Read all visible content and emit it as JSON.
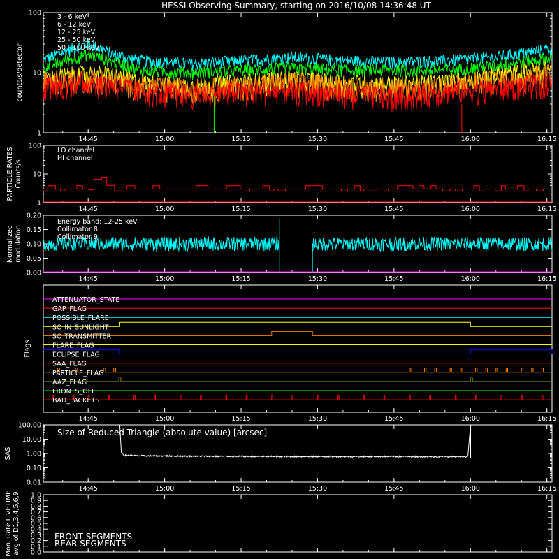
{
  "title": "HESSI Observing Summary, starting on 2016/10/08 14:36:48 UT",
  "x_ticks": [
    "14:45",
    "15:00",
    "15:15",
    "15:30",
    "15:45",
    "16:00",
    "16:15"
  ],
  "x_tick_minutes": [
    0,
    15,
    30,
    45,
    60,
    75,
    90
  ],
  "x_range_minutes": [
    -8.8,
    91.0
  ],
  "colors": {
    "bg": "#000000",
    "axis": "#ffffff",
    "red": "#ff0000",
    "orange": "#ff8000",
    "yellow": "#ffff00",
    "green": "#00ff00",
    "cyan": "#00ffff",
    "magenta": "#ff00ff",
    "blue": "#0000ff",
    "olive": "#808000",
    "lime": "#00ff00",
    "darkgreen": "#00a000"
  },
  "chart_data": [
    {
      "type": "line",
      "panel": "count-rates",
      "ylabel": "counts/s/detector",
      "yscale": "log",
      "ylim": [
        1,
        100
      ],
      "y_tick_labels": [
        "1",
        "10",
        "100"
      ],
      "y_tick_values": [
        1,
        10,
        100
      ],
      "series": [
        {
          "name": "3 - 6 keV",
          "color": "#ff0000",
          "x": [
            -8.8,
            0,
            5,
            10,
            20,
            30,
            40,
            50,
            60,
            70,
            80,
            91
          ],
          "y": [
            6,
            7,
            6.5,
            5,
            4.5,
            5,
            5,
            4.5,
            4,
            5,
            5.5,
            7
          ]
        },
        {
          "name": "6 - 12 keV",
          "color": "#ff8000",
          "x": [
            -8.8,
            0,
            5,
            10,
            20,
            30,
            40,
            50,
            60,
            70,
            80,
            91
          ],
          "y": [
            7,
            8,
            7.5,
            6,
            5.5,
            6,
            7,
            6,
            5.5,
            6,
            7.5,
            10
          ]
        },
        {
          "name": "12 - 25 keV",
          "color": "#ffff00",
          "x": [
            -8.8,
            0,
            5,
            10,
            20,
            30,
            40,
            50,
            60,
            70,
            80,
            91
          ],
          "y": [
            8,
            10,
            9,
            7,
            6,
            7,
            8,
            7,
            6.5,
            7,
            9,
            12
          ]
        },
        {
          "name": "25 - 50 keV",
          "color": "#00ff00",
          "x": [
            -8.8,
            0,
            5,
            10,
            20,
            30,
            40,
            50,
            60,
            70,
            80,
            91
          ],
          "y": [
            12,
            20,
            15,
            11,
            10,
            11,
            12,
            11,
            11,
            11,
            13,
            18
          ]
        },
        {
          "name": "50 - 100 keV",
          "color": "#00ffff",
          "x": [
            -8.8,
            0,
            5,
            10,
            20,
            30,
            40,
            50,
            60,
            70,
            80,
            91
          ],
          "y": [
            16,
            30,
            20,
            16,
            14,
            16,
            18,
            16,
            15,
            16,
            18,
            25
          ]
        }
      ]
    },
    {
      "type": "line",
      "panel": "particle-rates",
      "ylabel": "PARTICLE RATES Counts/s",
      "yscale": "log",
      "ylim": [
        1,
        100
      ],
      "y_tick_labels": [
        "1",
        "10",
        "100"
      ],
      "y_tick_values": [
        1,
        10,
        100
      ],
      "series": [
        {
          "name": "LO channel",
          "color": "#ff0000",
          "x": [
            -8.8,
            0,
            1,
            2,
            3,
            4,
            5,
            91
          ],
          "y": [
            3,
            3,
            6,
            10,
            6,
            4,
            3,
            3
          ]
        },
        {
          "name": "HI channel",
          "color": "#ff0000",
          "x": [
            -8.8,
            91
          ],
          "y": [
            1,
            1
          ]
        }
      ]
    },
    {
      "type": "line",
      "panel": "modulation",
      "ylabel": "Normalized modulation",
      "ylim": [
        0,
        0.2
      ],
      "y_tick_labels": [
        "0.00",
        "0.05",
        "0.10",
        "0.15",
        "0.20"
      ],
      "y_tick_values": [
        0,
        0.05,
        0.1,
        0.15,
        0.2
      ],
      "annotation": "Energy band: 12-25 keV",
      "gap_minutes": [
        37.5,
        44.0
      ],
      "series": [
        {
          "name": "Collimator 8",
          "color": "#00ffff",
          "x": [
            -8.8,
            37.5,
            44.0,
            91
          ],
          "y": [
            0.1,
            0.1,
            0.1,
            0.1
          ]
        },
        {
          "name": "Collimator 9",
          "color": "#ff00ff",
          "x": [],
          "y": []
        }
      ]
    },
    {
      "type": "line",
      "panel": "flags",
      "ylabel": "Flags",
      "flags": [
        {
          "name": "ATTENUATOR_STATE",
          "color": "#ff00ff",
          "on": []
        },
        {
          "name": "GAP_FLAG",
          "color": "#ff0000",
          "on": []
        },
        {
          "name": "POSSIBLE_FLARE",
          "color": "#00ffff",
          "on": []
        },
        {
          "name": "SC_IN_SUNLIGHT",
          "color": "#ffff00",
          "on": [
            [
              6.2,
              75.0
            ]
          ]
        },
        {
          "name": "SC_TRANSMITTER",
          "color": "#ff8000",
          "on": [
            [
              36.0,
              44.0
            ]
          ]
        },
        {
          "name": "FLARE_FLAG",
          "color": "#ffff00",
          "on": []
        },
        {
          "name": "ECLIPSE_FLAG",
          "color": "#0000ff",
          "on": [
            [
              -8.8,
              6.2
            ],
            [
              75.0,
              91.0
            ]
          ]
        },
        {
          "name": "SAA_FLAG",
          "color": "#ff0000",
          "on": []
        },
        {
          "name": "PARTICLE_FLAG",
          "color": "#ff8000",
          "on": [
            [
              -6,
              -5.6
            ],
            [
              -2.5,
              -2.1
            ],
            [
              3,
              3.4
            ],
            [
              5,
              5.4
            ],
            [
              63,
              63.3
            ],
            [
              66,
              66.3
            ],
            [
              68,
              68.3
            ],
            [
              71,
              71.3
            ],
            [
              73,
              73.3
            ],
            [
              76,
              76.3
            ],
            [
              78,
              78.3
            ],
            [
              80,
              80.3
            ],
            [
              82,
              82.3
            ],
            [
              85,
              85.3
            ],
            [
              87,
              87.3
            ],
            [
              89,
              89.3
            ]
          ]
        },
        {
          "name": "AAZ_FLAG",
          "color": "#808000",
          "on": [
            [
              6.0,
              6.4
            ],
            [
              75.0,
              75.4
            ]
          ]
        },
        {
          "name": "FRONTS_OFF",
          "color": "#00ff00",
          "on": []
        },
        {
          "name": "BAD_PACKETS",
          "color": "#ff0000",
          "on": [
            [
              -7,
              -6.8
            ],
            [
              -3,
              -2.8
            ],
            [
              0,
              0.2
            ],
            [
              4,
              4.2
            ],
            [
              9,
              9.2
            ],
            [
              13,
              13.2
            ],
            [
              18,
              18.2
            ],
            [
              22,
              22.2
            ],
            [
              27,
              27.2
            ],
            [
              31,
              31.2
            ],
            [
              36,
              36.2
            ],
            [
              40,
              40.2
            ],
            [
              45,
              45.2
            ],
            [
              49,
              49.2
            ],
            [
              54,
              54.2
            ],
            [
              58,
              58.2
            ],
            [
              63,
              63.2
            ],
            [
              67,
              67.2
            ],
            [
              72,
              72.2
            ],
            [
              76,
              76.2
            ],
            [
              81,
              81.2
            ],
            [
              85,
              85.2
            ],
            [
              89,
              89.2
            ]
          ]
        }
      ]
    },
    {
      "type": "line",
      "panel": "sas",
      "ylabel": "SAS",
      "yscale": "log",
      "ylim": [
        0.01,
        100
      ],
      "y_tick_labels": [
        "0.01",
        "0.10",
        "1.00",
        "10.00",
        "100.00"
      ],
      "y_tick_values": [
        0.01,
        0.1,
        1,
        10,
        100
      ],
      "annotation": "Size of Reduced Triangle (absolute value) [arcsec]",
      "series": [
        {
          "name": "Size of Reduced Triangle",
          "color": "#ffffff",
          "x": [
            6.2,
            6.5,
            7,
            10,
            20,
            40,
            60,
            74.5,
            75.0
          ],
          "y": [
            100,
            1.2,
            0.75,
            0.7,
            0.65,
            0.62,
            0.62,
            0.6,
            100
          ]
        }
      ]
    },
    {
      "type": "line",
      "panel": "livetime",
      "ylabel": "Mon. Rate LIVETIME avg of D1,3,4,5,6,9",
      "ylim": [
        0,
        1.0
      ],
      "y_tick_labels": [
        "0.0",
        "0.1",
        "0.2",
        "0.3",
        "0.4",
        "0.5",
        "0.6",
        "0.7",
        "0.8",
        "0.9",
        "1.0"
      ],
      "y_tick_values": [
        0,
        0.1,
        0.2,
        0.3,
        0.4,
        0.5,
        0.6,
        0.7,
        0.8,
        0.9,
        1.0
      ],
      "series": [
        {
          "name": "FRONT SEGMENTS",
          "color": "#00ff00",
          "x": [],
          "y": []
        },
        {
          "name": "REAR SEGMENTS",
          "color": "#00a000",
          "x": [],
          "y": []
        }
      ]
    }
  ]
}
